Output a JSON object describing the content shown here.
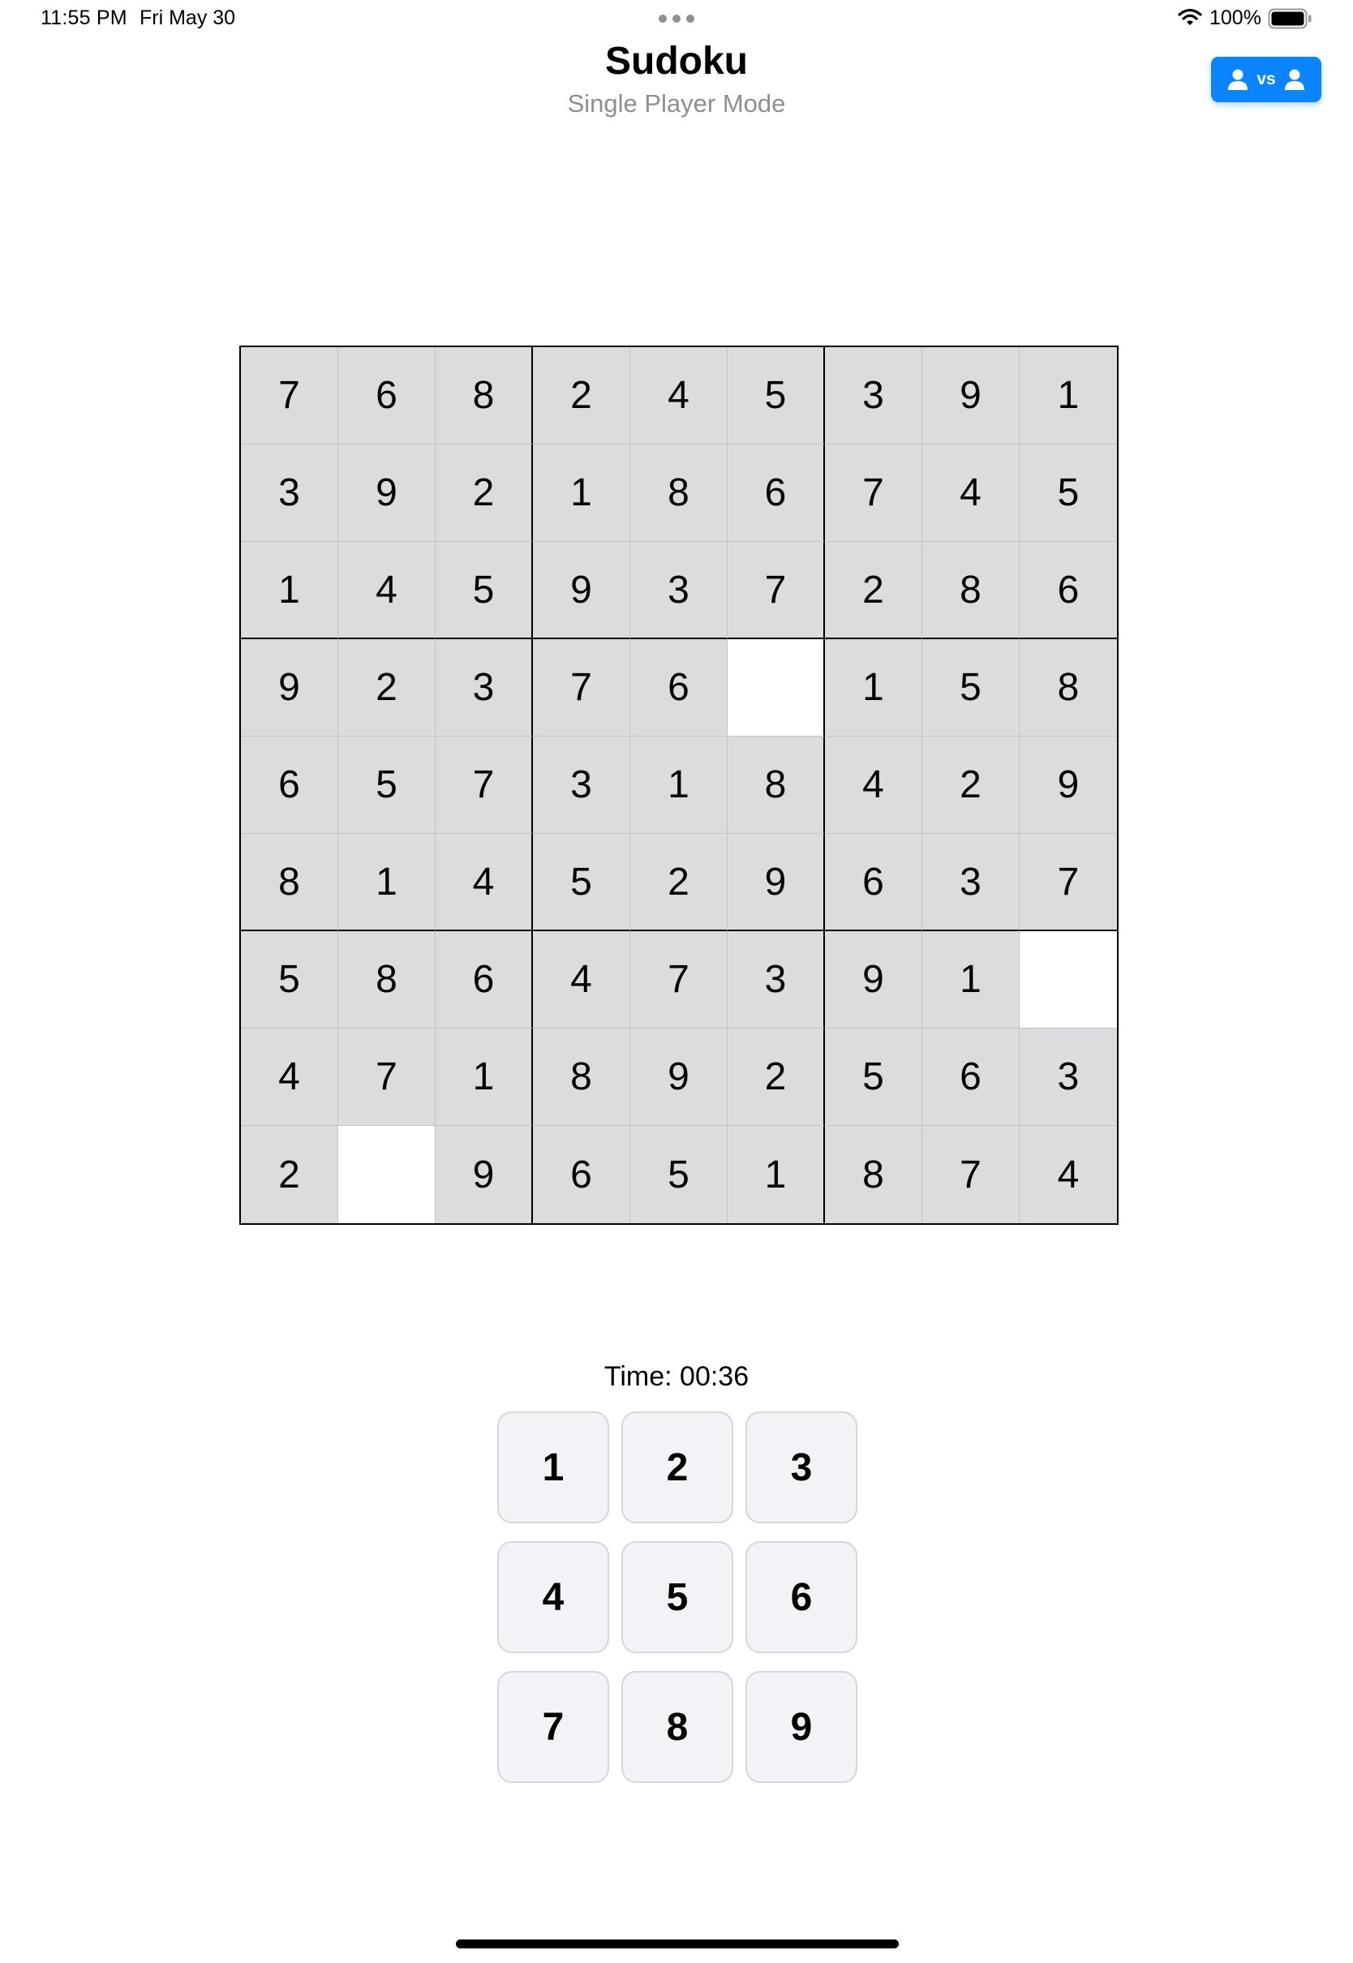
{
  "status_bar": {
    "time": "11:55 PM",
    "date": "Fri May 30",
    "battery": "100%",
    "icons": [
      "wifi-icon",
      "battery-icon",
      "multitask-dots-icon"
    ]
  },
  "header": {
    "title": "Sudoku",
    "subtitle": "Single Player Mode",
    "mode_button": {
      "label": "vs",
      "icons": [
        "person-icon",
        "person-icon"
      ],
      "color": "#0a84ff"
    }
  },
  "board": {
    "rows": [
      [
        "7",
        "6",
        "8",
        "2",
        "4",
        "5",
        "3",
        "9",
        "1"
      ],
      [
        "3",
        "9",
        "2",
        "1",
        "8",
        "6",
        "7",
        "4",
        "5"
      ],
      [
        "1",
        "4",
        "5",
        "9",
        "3",
        "7",
        "2",
        "8",
        "6"
      ],
      [
        "9",
        "2",
        "3",
        "7",
        "6",
        "",
        "1",
        "5",
        "8"
      ],
      [
        "6",
        "5",
        "7",
        "3",
        "1",
        "8",
        "4",
        "2",
        "9"
      ],
      [
        "8",
        "1",
        "4",
        "5",
        "2",
        "9",
        "6",
        "3",
        "7"
      ],
      [
        "5",
        "8",
        "6",
        "4",
        "7",
        "3",
        "9",
        "1",
        ""
      ],
      [
        "4",
        "7",
        "1",
        "8",
        "9",
        "2",
        "5",
        "6",
        "3"
      ],
      [
        "2",
        "",
        "9",
        "6",
        "5",
        "1",
        "8",
        "7",
        "4"
      ]
    ],
    "filled_cell_color": "#dcdcde",
    "empty_cell_color": "#ffffff"
  },
  "timer": {
    "text": "Time: 00:36"
  },
  "numpad": {
    "keys": [
      "1",
      "2",
      "3",
      "4",
      "5",
      "6",
      "7",
      "8",
      "9"
    ]
  }
}
